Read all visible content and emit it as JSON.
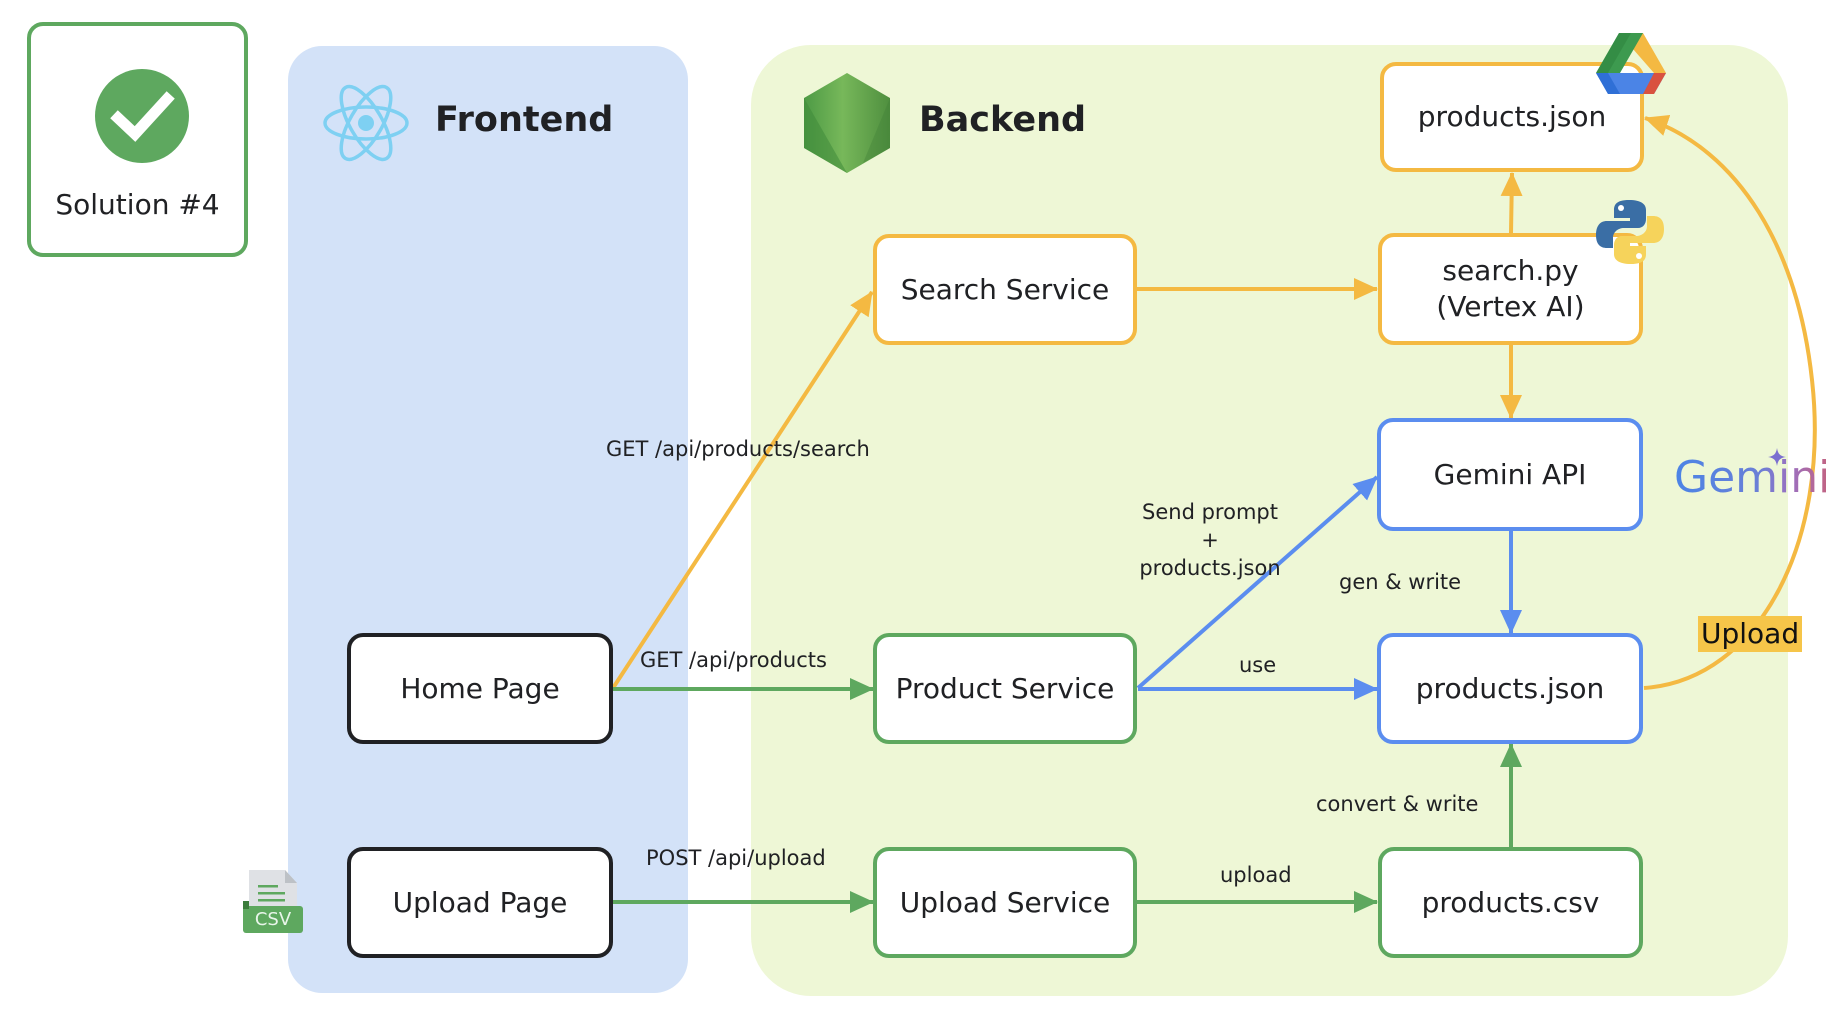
{
  "badge": {
    "icon": "check-circle-icon",
    "label": "Solution #4",
    "color": "#5ea85f"
  },
  "panels": {
    "frontend": {
      "title": "Frontend",
      "icon": "react-icon",
      "color": "#d3e2f8"
    },
    "backend": {
      "title": "Backend",
      "icon": "nodejs-icon",
      "color": "#eef7d6"
    }
  },
  "nodes": {
    "home_page": "Home Page",
    "upload_page": "Upload Page",
    "search_service": "Search Service",
    "product_service": "Product Service",
    "upload_service": "Upload Service",
    "products_json_drive": "products.json",
    "search_py_line1": "search.py",
    "search_py_line2": "(Vertex AI)",
    "gemini_api": "Gemini API",
    "products_json_local": "products.json",
    "products_csv": "products.csv"
  },
  "edges": {
    "get_search": "GET /api/products/search",
    "get_products": "GET /api/products",
    "post_upload": "POST /api/upload",
    "send_prompt_line1": "Send prompt",
    "send_prompt_line2": "+",
    "send_prompt_line3": "products.json",
    "gen_write": "gen & write",
    "use": "use",
    "convert_write": "convert & write",
    "upload": "upload",
    "upload_drive": "Upload"
  },
  "logos": {
    "gemini": "Gemini",
    "csv": "CSV",
    "drive": "google-drive-icon",
    "python": "python-icon"
  },
  "colors": {
    "green": "#5ea85f",
    "yellow": "#f4b942",
    "blue": "#5b8def",
    "dark": "#202124"
  }
}
